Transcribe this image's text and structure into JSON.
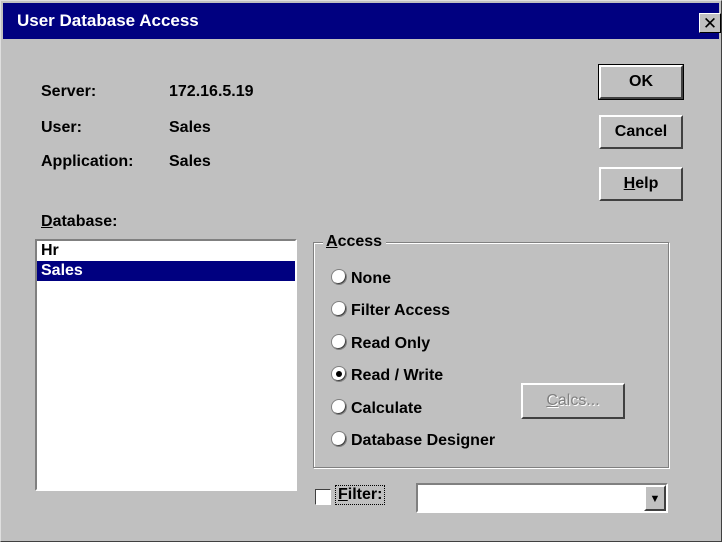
{
  "window": {
    "title": "User Database Access",
    "close_glyph": "✕"
  },
  "info": {
    "server_label": "Server:",
    "server_value": "172.16.5.19",
    "user_label": "User:",
    "user_value": "Sales",
    "application_label": "Application:",
    "application_value": "Sales"
  },
  "buttons": {
    "ok": "OK",
    "cancel": "Cancel",
    "help_accel": "H",
    "help_rest": "elp",
    "calcs_accel": "C",
    "calcs_rest": "alcs..."
  },
  "database": {
    "label_accel": "D",
    "label_rest": "atabase:",
    "items": [
      "Hr",
      "Sales"
    ],
    "selected": "Sales"
  },
  "access": {
    "title_accel": "A",
    "title_rest": "ccess",
    "options": [
      "None",
      "Filter Access",
      "Read Only",
      "Read / Write",
      "Calculate",
      "Database Designer"
    ],
    "selected": "Read / Write"
  },
  "filter": {
    "label_accel": "F",
    "label_rest": "ilter:",
    "checked": false,
    "value": "",
    "arrow_glyph": "▼"
  }
}
